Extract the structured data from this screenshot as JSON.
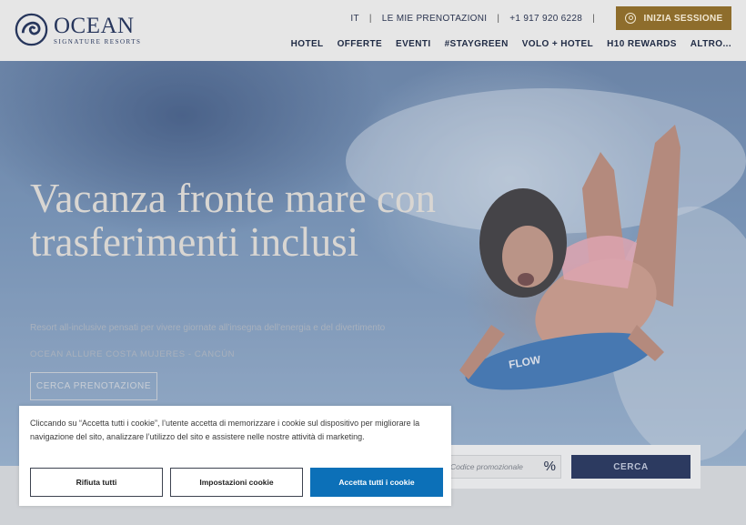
{
  "brand": {
    "name": "OCEAN",
    "tagline": "SIGNATURE RESORTS",
    "color": "#27365c"
  },
  "topbar": {
    "language": "IT",
    "bookings": "LE MIE PRENOTAZIONI",
    "phone": "+1 917 920 6228",
    "login": "INIZIA SESSIONE",
    "login_icon": "user-icon",
    "accent": "#8e6d2c"
  },
  "nav": {
    "items": [
      "HOTEL",
      "OFFERTE",
      "EVENTI",
      "#STAYGREEN",
      "VOLO + HOTEL",
      "H10 REWARDS",
      "ALTRO..."
    ]
  },
  "hero": {
    "title": "Vacanza fronte mare con trasferimenti inclusi",
    "subtitle": "Resort all-inclusive pensati per vivere giornate all’insegna dell’energia e del divertimento",
    "hotel": "OCEAN ALLURE COSTA MUJERES - CANCÚN",
    "cta": "CERCA PRENOTAZIONE"
  },
  "booking": {
    "promo_placeholder": "Codice promozionale",
    "promo_icon": "percent-icon",
    "search": "CERCA"
  },
  "cookie": {
    "text": "Cliccando su “Accetta tutti i cookie”, l’utente accetta di memorizzare i cookie sul dispositivo per migliorare la navigazione del sito, analizzare l’utilizzo del sito e assistere nelle nostre attività di marketing.",
    "reject": "Rifiuta tutti",
    "settings": "Impostazioni cookie",
    "accept": "Accetta tutti i cookie",
    "accept_color": "#0c70b8"
  }
}
